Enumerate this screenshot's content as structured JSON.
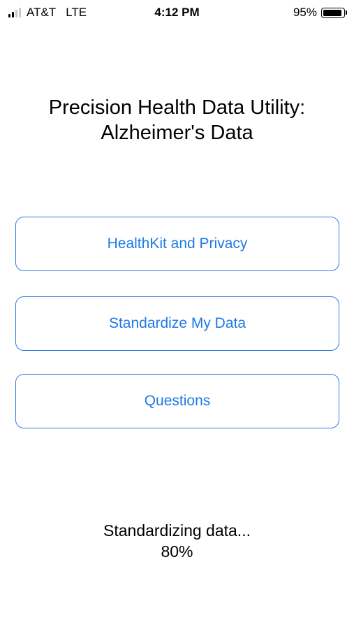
{
  "status_bar": {
    "carrier": "AT&T",
    "network": "LTE",
    "time": "4:12 PM",
    "battery": "95%",
    "battery_level": 0.95,
    "signal_bars": 4,
    "signal_active": 2
  },
  "title": {
    "line1": "Precision Health Data Utility:",
    "line2": "Alzheimer's Data"
  },
  "buttons": [
    {
      "label": "HealthKit and Privacy"
    },
    {
      "label": "Standardize My Data"
    },
    {
      "label": "Questions"
    }
  ],
  "progress": {
    "message": "Standardizing data...",
    "percent": "80%"
  },
  "colors": {
    "accent": "#1e7ae6"
  }
}
